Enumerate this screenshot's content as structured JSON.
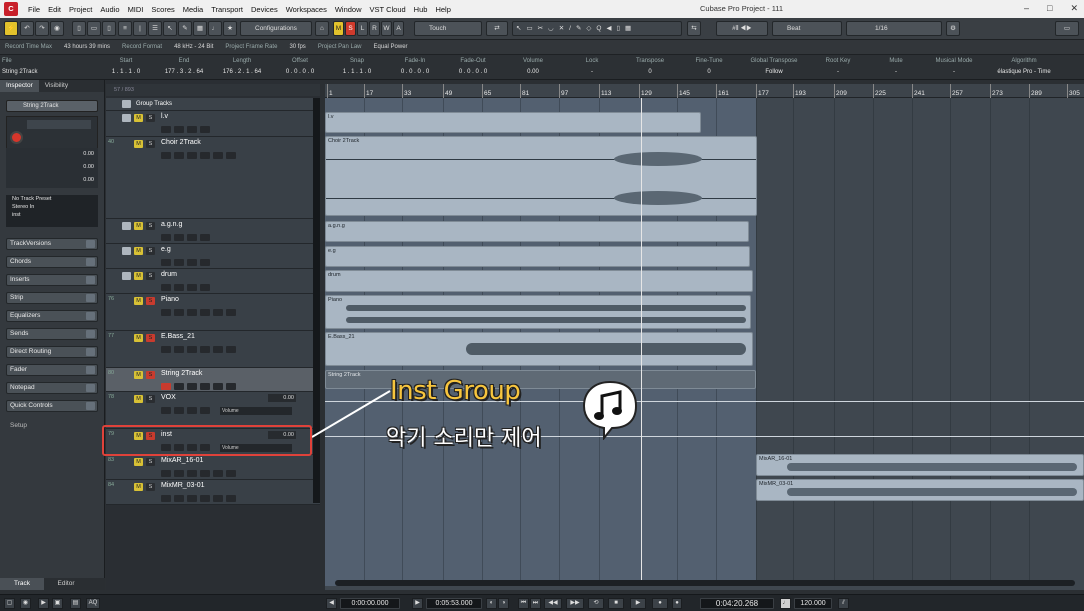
{
  "menubar": {
    "items": [
      "File",
      "Edit",
      "Project",
      "Audio",
      "MIDI",
      "Scores",
      "Media",
      "Transport",
      "Devices",
      "Workspaces",
      "Window",
      "VST Cloud",
      "Hub",
      "Help"
    ],
    "title": "Cubase Pro Project - 111"
  },
  "toolbar": {
    "configurations": "Configurations",
    "m": "M",
    "s": "S",
    "l": "L",
    "r": "R",
    "w": "W",
    "a": "A",
    "automation_mode": "Touch",
    "snap": "Beat",
    "quantize": "1/16"
  },
  "status": {
    "record_time_max_label": "Record Time Max",
    "record_time_max": "43 hours 39 mins",
    "record_format_label": "Record Format",
    "record_format": "48 kHz - 24 Bit",
    "frame_rate_label": "Project Frame Rate",
    "frame_rate": "30 fps",
    "pan_law_label": "Project Pan Law",
    "pan_law": "Equal Power"
  },
  "infoline": [
    {
      "h": "File",
      "v": "String 2Track"
    },
    {
      "h": "Start",
      "v": "1 . 1 . 1 . 0"
    },
    {
      "h": "End",
      "v": "177 . 3 . 2 . 64"
    },
    {
      "h": "Length",
      "v": "176 . 2 . 1 . 64"
    },
    {
      "h": "Offset",
      "v": "0 . 0 . 0 . 0"
    },
    {
      "h": "Snap",
      "v": "1 . 1 . 1 . 0"
    },
    {
      "h": "Fade-In",
      "v": "0 . 0 . 0 . 0"
    },
    {
      "h": "Fade-Out",
      "v": "0 . 0 . 0 . 0"
    },
    {
      "h": "Volume",
      "v": "0.00"
    },
    {
      "h": "Lock",
      "v": "-"
    },
    {
      "h": "Transpose",
      "v": "0"
    },
    {
      "h": "Fine-Tune",
      "v": "0"
    },
    {
      "h": "Global Transpose",
      "v": "Follow"
    },
    {
      "h": "Root Key",
      "v": "-"
    },
    {
      "h": "Mute",
      "v": "-"
    },
    {
      "h": "Musical Mode",
      "v": "-"
    },
    {
      "h": "Algorithm",
      "v": "élastique Pro - Time"
    }
  ],
  "inspector": {
    "tabs": [
      "Inspector",
      "Visibility"
    ],
    "track_name": "String 2Track",
    "vol1": "0.00",
    "vol2": "0.00",
    "vol3": "0.00",
    "preset": "No Track Preset",
    "input": "Stereo In",
    "output": "inst",
    "sections": [
      "TrackVersions",
      "Chords",
      "Inserts",
      "Strip",
      "Equalizers",
      "Sends",
      "Direct Routing",
      "Fader",
      "Notepad",
      "Quick Controls"
    ],
    "setup": "Setup",
    "bottom_tabs": [
      "Track",
      "Editor"
    ]
  },
  "tracklist": {
    "counter": "57 / 893",
    "tracks": [
      {
        "num": "",
        "name": "Group Tracks",
        "group": true
      },
      {
        "num": "",
        "name": "l.v"
      },
      {
        "num": "40",
        "name": "Choir 2Track"
      },
      {
        "num": "",
        "name": "a.g.n.g"
      },
      {
        "num": "",
        "name": "e.g"
      },
      {
        "num": "",
        "name": "drum"
      },
      {
        "num": "76",
        "name": "Piano"
      },
      {
        "num": "77",
        "name": "E.Bass_21"
      },
      {
        "num": "80",
        "name": "String 2Track"
      },
      {
        "num": "78",
        "name": "VOX",
        "vol": "0.00",
        "vollabel": "Volume"
      },
      {
        "num": "79",
        "name": "inst",
        "vol": "0.00",
        "vollabel": "Volume"
      },
      {
        "num": "83",
        "name": "MixAR_16-01"
      },
      {
        "num": "84",
        "name": "MixMR_03-01"
      }
    ]
  },
  "ruler": {
    "ticks": [
      "1",
      "17",
      "33",
      "49",
      "65",
      "81",
      "97",
      "113",
      "129",
      "145",
      "161",
      "177",
      "193",
      "209",
      "225",
      "241",
      "257",
      "273",
      "289",
      "305"
    ]
  },
  "events": [
    "l.v",
    "Choir 2Track",
    "a.g.n.g",
    "e.g",
    "drum",
    "Piano",
    "E.Bass_21",
    "String 2Track",
    "MixAR_16-01",
    "MixMR_03-01"
  ],
  "transport": {
    "left": "0:00:00.000",
    "right": "0:05:53.000",
    "position": "0:04:20.268",
    "tempo": "120.000",
    "aq": "AQ"
  },
  "annotation": {
    "title": "Inst Group",
    "subtitle": "악기 소리만 제어",
    "colors": {
      "title": "#f7c53e",
      "callout": "#e0423a"
    }
  }
}
